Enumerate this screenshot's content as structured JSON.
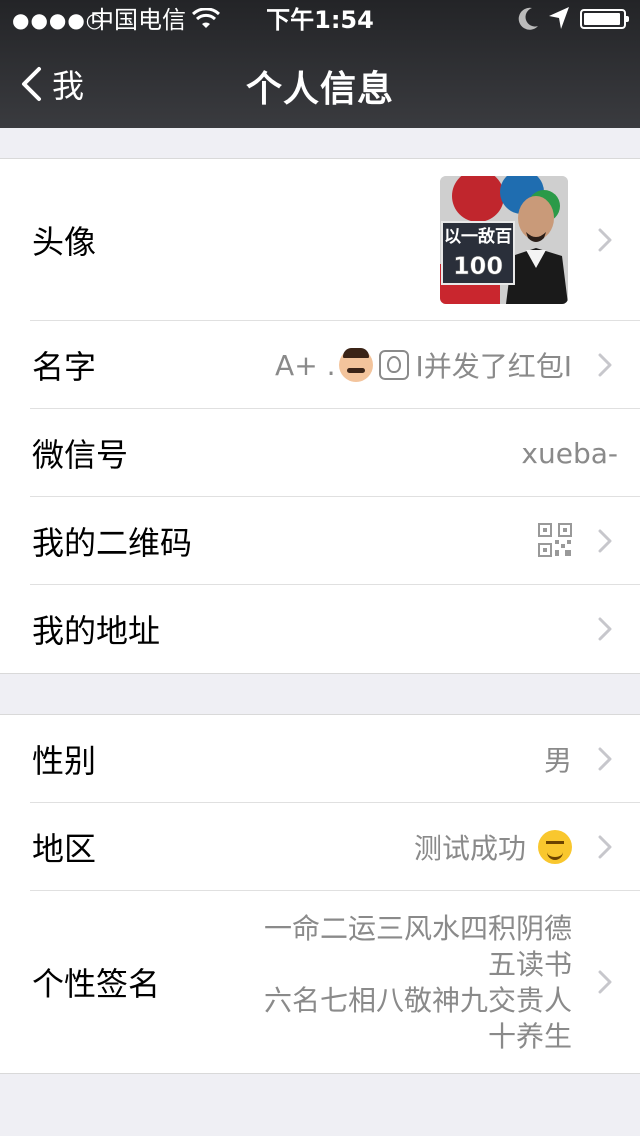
{
  "status_bar": {
    "signal": "●●●●○",
    "carrier": "中国电信",
    "time": "下午1:54"
  },
  "nav": {
    "back_label": "我",
    "title": "个人信息"
  },
  "section1": {
    "avatar_label": "头像",
    "avatar_text_top": "以一敌百",
    "avatar_text_bottom": "100",
    "name_label": "名字",
    "name_value_prefix": "A+  .",
    "name_value_suffix": "I并发了红包I",
    "wechat_id_label": "微信号",
    "wechat_id_value": "xueba-",
    "qr_label": "我的二维码",
    "address_label": "我的地址"
  },
  "section2": {
    "gender_label": "性别",
    "gender_value": "男",
    "region_label": "地区",
    "region_value": "测试成功",
    "signature_label": "个性签名",
    "signature_lines": [
      "一命二运三风水四积阴德",
      "五读书",
      "六名七相八敬神九交贵人",
      "十养生"
    ]
  },
  "icons": [
    "wifi-icon",
    "moon-icon",
    "location-icon",
    "battery-icon",
    "back-chevron-icon",
    "chevron-right-icon",
    "qr-code-icon",
    "smile-emoji-icon"
  ]
}
